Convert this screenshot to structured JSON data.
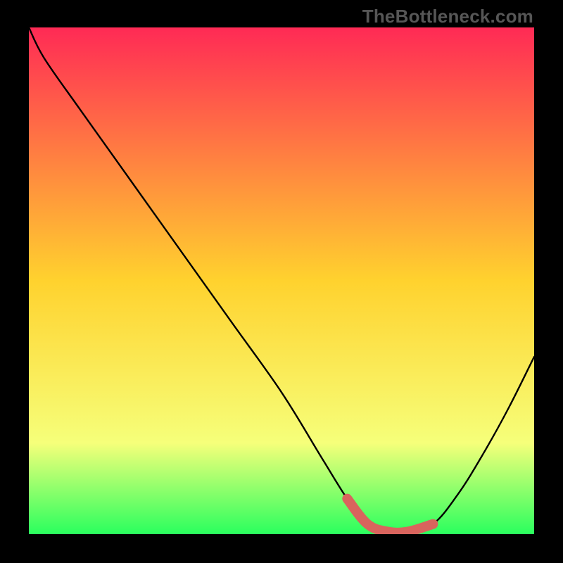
{
  "watermark": "TheBottleneck.com",
  "colors": {
    "frame": "#000000",
    "grad_top": "#ff2a55",
    "grad_mid": "#ffd22e",
    "grad_low": "#f6ff7a",
    "grad_bottom": "#2aff5e",
    "curve": "#000000",
    "highlight": "#d9645d"
  },
  "chart_data": {
    "type": "line",
    "title": "",
    "xlabel": "",
    "ylabel": "",
    "xlim": [
      0,
      100
    ],
    "ylim": [
      0,
      100
    ],
    "series": [
      {
        "name": "bottleneck-curve",
        "x": [
          0,
          3,
          10,
          20,
          30,
          40,
          50,
          58,
          63,
          67,
          71,
          75,
          80,
          85,
          90,
          95,
          100
        ],
        "y": [
          100,
          94,
          84,
          70,
          56,
          42,
          28,
          15,
          7,
          2,
          0.5,
          0.5,
          2,
          8,
          16,
          25,
          35
        ]
      }
    ],
    "highlight_segment": {
      "name": "optimal-range",
      "x": [
        63,
        67,
        71,
        75,
        80
      ],
      "y": [
        7,
        2,
        0.5,
        0.5,
        2
      ]
    }
  }
}
